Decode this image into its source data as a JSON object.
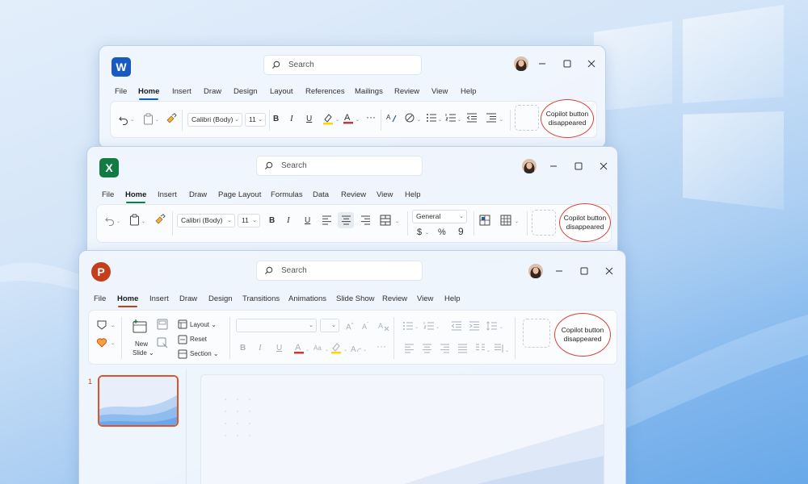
{
  "colors": {
    "word": "#185abd",
    "excel": "#107c41",
    "powerpoint": "#c43e1c",
    "callout_border": "#d9423a",
    "font_color_red": "#d13438",
    "highlight_yellow": "#ffd600"
  },
  "word": {
    "logo": "W",
    "search_placeholder": "Search",
    "menu": [
      "File",
      "Home",
      "Insert",
      "Draw",
      "Design",
      "Layout",
      "References",
      "Mailings",
      "Review",
      "View",
      "Help"
    ],
    "font_name": "Calibri (Body)",
    "font_size": "11",
    "callout": "Copilot button disappeared"
  },
  "excel": {
    "logo": "X",
    "search_placeholder": "Search",
    "menu": [
      "File",
      "Home",
      "Insert",
      "Draw",
      "Page Layout",
      "Formulas",
      "Data",
      "Review",
      "View",
      "Help"
    ],
    "font_name": "Calibri (Body)",
    "font_size": "11",
    "number_format": "General",
    "callout": "Copilot button disappeared"
  },
  "powerpoint": {
    "logo": "P",
    "search_placeholder": "Search",
    "menu": [
      "File",
      "Home",
      "Insert",
      "Draw",
      "Design",
      "Transitions",
      "Animations",
      "Slide Show",
      "Review",
      "View",
      "Help"
    ],
    "new_slide_label": [
      "New",
      "Slide"
    ],
    "layout_label": "Layout",
    "reset_label": "Reset",
    "section_label": "Section",
    "callout": "Copilot button disappeared",
    "slide_number": "1"
  }
}
